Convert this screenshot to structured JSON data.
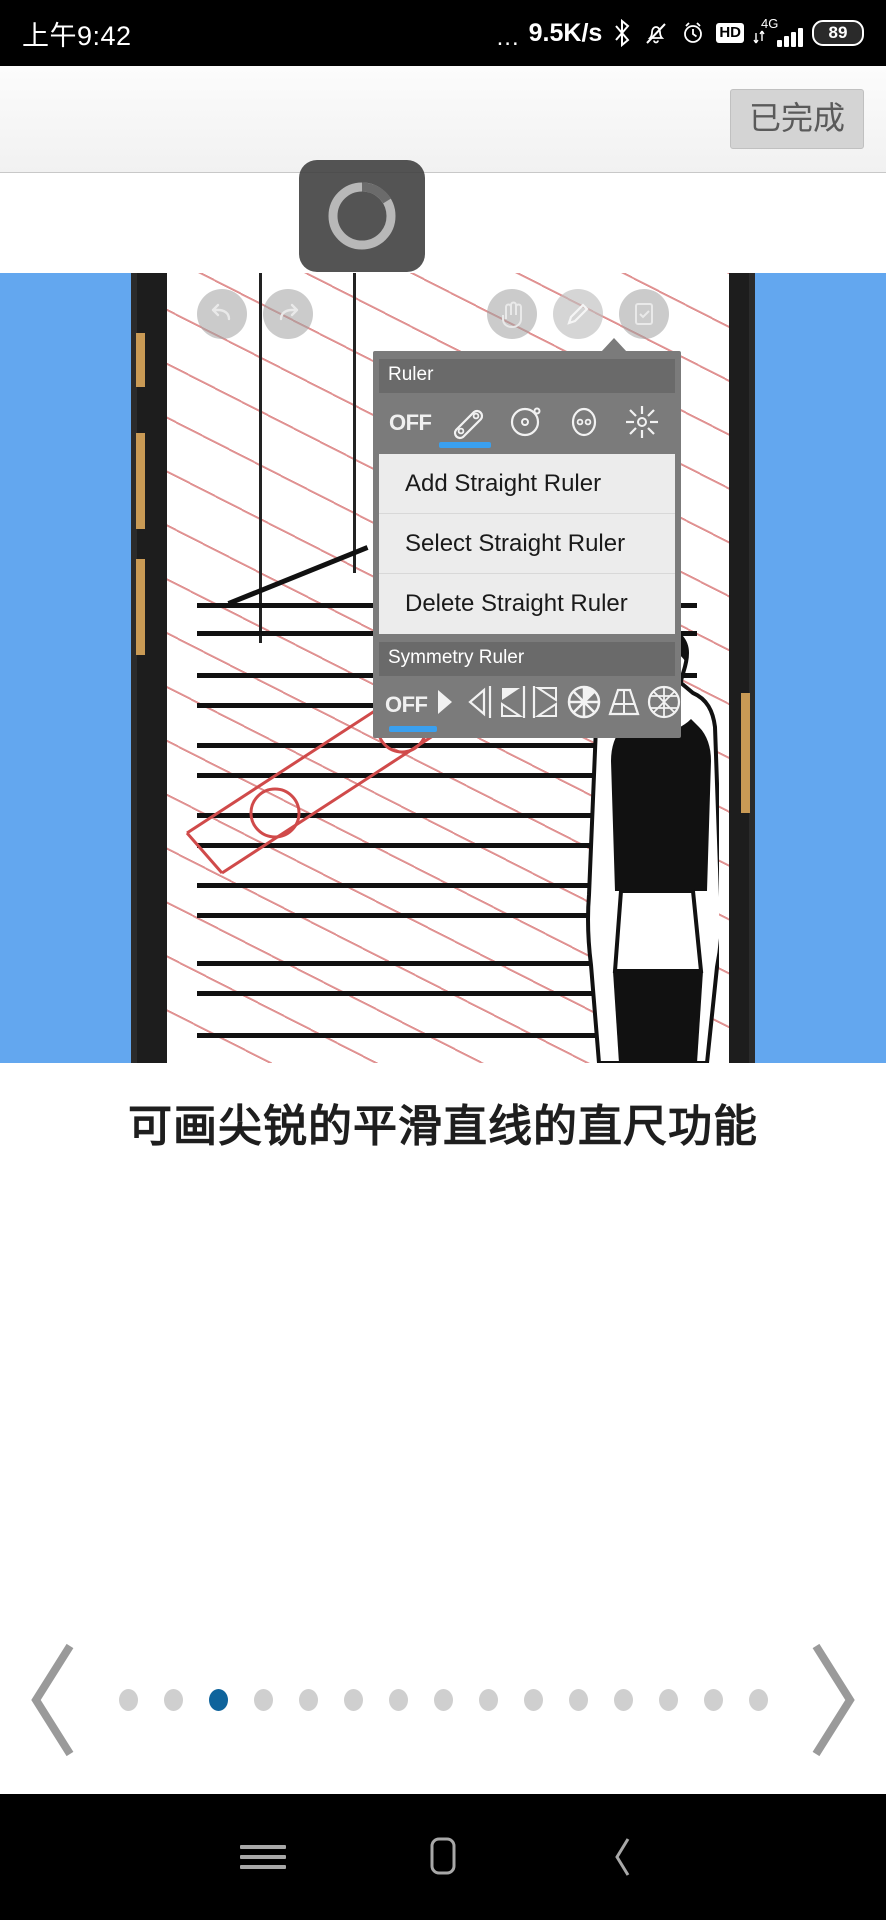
{
  "status_bar": {
    "clock": "上午9:42",
    "network_speed": "9.5K/s",
    "speed_prefix": "...",
    "bluetooth_icon": "bluetooth-icon",
    "mute_icon": "bell-muted-icon",
    "alarm_icon": "alarm-clock-icon",
    "hd_label": "HD",
    "network_type": "4G",
    "battery_level": "89"
  },
  "top_bar": {
    "done_label": "已完成"
  },
  "loading": {
    "spinner_name": "loading-spinner"
  },
  "hero": {
    "background_color": "#63a7ef",
    "app_toolbar": {
      "undo_icon": "undo-icon",
      "redo_icon": "redo-icon",
      "hand_icon": "hand-tool-icon",
      "pencil_icon": "pencil-tool-icon",
      "export_icon": "export-image-icon"
    },
    "ruler_popup": {
      "ruler_section_title": "Ruler",
      "ruler_modes": [
        {
          "label": "OFF",
          "name": "ruler-off-option",
          "selected": false
        },
        {
          "label": "",
          "name": "straight-ruler-option",
          "selected": true
        },
        {
          "label": "",
          "name": "circle-ruler-option",
          "selected": false
        },
        {
          "label": "",
          "name": "ellipse-ruler-option",
          "selected": false
        },
        {
          "label": "",
          "name": "radial-ruler-option",
          "selected": false
        }
      ],
      "menu_items": [
        "Add Straight Ruler",
        "Select Straight Ruler",
        "Delete Straight Ruler"
      ],
      "symmetry_section_title": "Symmetry Ruler",
      "symmetry_modes": [
        {
          "label": "OFF",
          "name": "symmetry-off-option",
          "selected": true
        },
        {
          "label": "",
          "name": "symmetry-vertical-option",
          "selected": false
        },
        {
          "label": "",
          "name": "symmetry-horizontal-option",
          "selected": false
        },
        {
          "label": "",
          "name": "symmetry-quad-option",
          "selected": false
        },
        {
          "label": "",
          "name": "symmetry-radial-option",
          "selected": false
        },
        {
          "label": "",
          "name": "symmetry-perspective-option",
          "selected": false
        },
        {
          "label": "",
          "name": "symmetry-box-option",
          "selected": false
        }
      ]
    }
  },
  "caption": {
    "text": "可画尖锐的平滑直线的直尺功能"
  },
  "pager": {
    "prev_icon": "chevron-left-icon",
    "next_icon": "chevron-right-icon",
    "total_pages": 15,
    "active_index": 2,
    "active_color": "#0f649c",
    "inactive_color": "#cfcfcf"
  },
  "nav_bar": {
    "menu_icon": "menu-icon",
    "home_icon": "home-icon",
    "back_icon": "back-icon"
  }
}
